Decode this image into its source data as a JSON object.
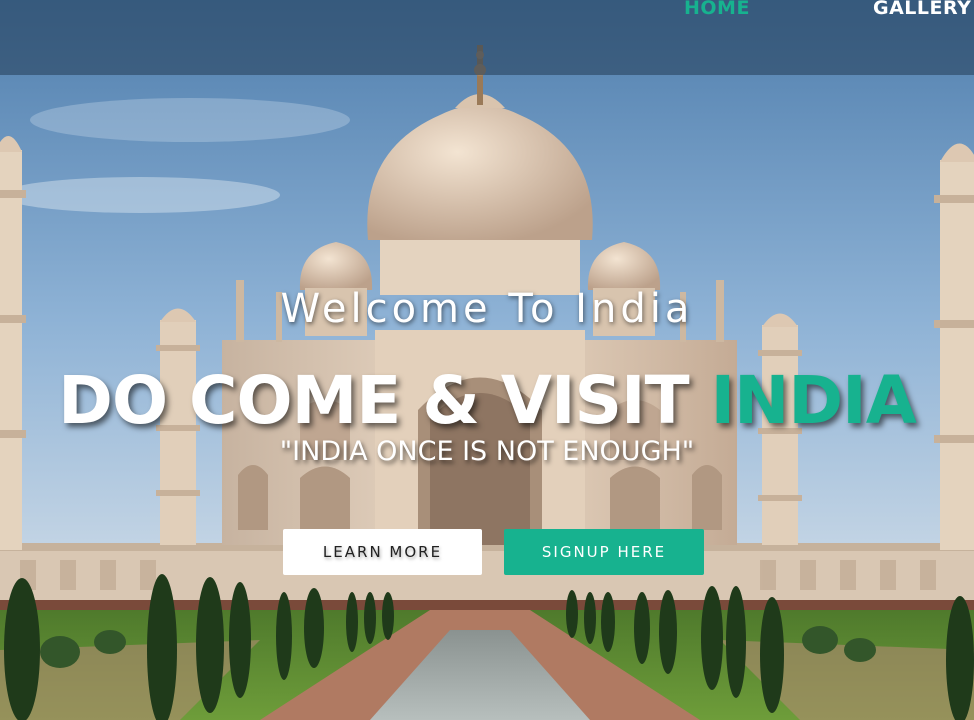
{
  "nav": {
    "home_label": "HOME",
    "gallery_label": "GALLERY"
  },
  "hero": {
    "welcome": "Welcome To India",
    "headline_main": "DO COME & VISIT ",
    "headline_accent": "INDIA",
    "tagline": "\"INDIA ONCE IS NOT ENOUGH\""
  },
  "buttons": {
    "learn_more": "LEARN MORE",
    "signup": "SIGNUP HERE"
  },
  "colors": {
    "accent": "#17b28f",
    "navbar_bg": "rgba(35,60,85,0.55)",
    "button_light": "#ffffff"
  }
}
